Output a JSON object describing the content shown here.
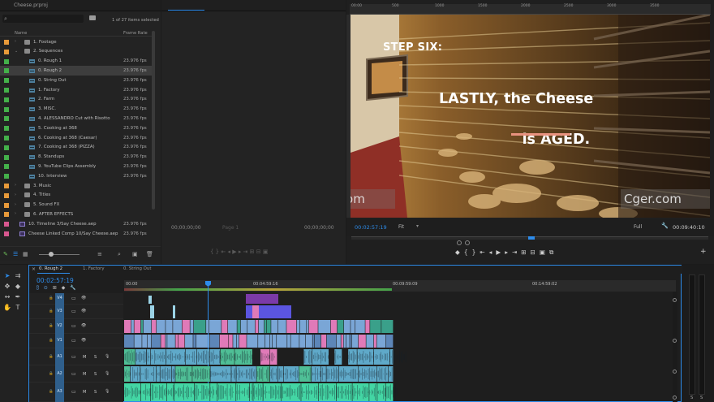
{
  "project": {
    "tab": "Cheese.prproj",
    "search_placeholder": "⌕",
    "selection_count": "1 of 27 items selected",
    "col_name": "Name",
    "col_fps": "Frame Rate",
    "items": [
      {
        "name": "1. Footage",
        "fps": "",
        "type": "folder",
        "label": "#e89a3a",
        "indent": 0
      },
      {
        "name": "2. Sequences",
        "fps": "",
        "type": "folder",
        "label": "#e89a3a",
        "indent": 0,
        "open": true
      },
      {
        "name": "0. Rough 1",
        "fps": "23.976 fps",
        "type": "seq",
        "label": "#44b04a",
        "indent": 1
      },
      {
        "name": "0. Rough 2",
        "fps": "23.976 fps",
        "type": "seq",
        "label": "#44b04a",
        "indent": 1,
        "selected": true
      },
      {
        "name": "0. String Out",
        "fps": "23.976 fps",
        "type": "seq",
        "label": "#44b04a",
        "indent": 1
      },
      {
        "name": "1. Factory",
        "fps": "23.976 fps",
        "type": "seq",
        "label": "#44b04a",
        "indent": 1
      },
      {
        "name": "2. Farm",
        "fps": "23.976 fps",
        "type": "seq",
        "label": "#44b04a",
        "indent": 1
      },
      {
        "name": "3. MISC.",
        "fps": "23.976 fps",
        "type": "seq",
        "label": "#44b04a",
        "indent": 1
      },
      {
        "name": "4. ALESSANDRO Cut with Risotto",
        "fps": "23.976 fps",
        "type": "seq",
        "label": "#44b04a",
        "indent": 1
      },
      {
        "name": "5. Cooking at 368",
        "fps": "23.976 fps",
        "type": "seq",
        "label": "#44b04a",
        "indent": 1
      },
      {
        "name": "6. Cooking at 368 (Caesar)",
        "fps": "23.976 fps",
        "type": "seq",
        "label": "#44b04a",
        "indent": 1
      },
      {
        "name": "7. Cooking at 368 (PIZZA)",
        "fps": "23.976 fps",
        "type": "seq",
        "label": "#44b04a",
        "indent": 1
      },
      {
        "name": "8. Standups",
        "fps": "23.976 fps",
        "type": "seq",
        "label": "#44b04a",
        "indent": 1
      },
      {
        "name": "9. YouTube Clips Assembly",
        "fps": "23.976 fps",
        "type": "seq",
        "label": "#44b04a",
        "indent": 1
      },
      {
        "name": "10. Interview",
        "fps": "23.976 fps",
        "type": "seq",
        "label": "#44b04a",
        "indent": 1
      },
      {
        "name": "3. Music",
        "fps": "",
        "type": "folder",
        "label": "#e89a3a",
        "indent": 0
      },
      {
        "name": "4. Titles",
        "fps": "",
        "type": "folder",
        "label": "#e89a3a",
        "indent": 0
      },
      {
        "name": "5. Sound FX",
        "fps": "",
        "type": "folder",
        "label": "#e89a3a",
        "indent": 0
      },
      {
        "name": "6. AFTER EFFECTS",
        "fps": "",
        "type": "folder",
        "label": "#e89a3a",
        "indent": 0
      },
      {
        "name": "10. Timeline 3/Say Cheese.aep",
        "fps": "23.976 fps",
        "type": "ae",
        "label": "#d8578f",
        "indent": 0
      },
      {
        "name": "Cheese Linked Comp 10/Say Cheese.aep",
        "fps": "23.976 fps",
        "type": "ae",
        "label": "#d8578f",
        "indent": 0
      }
    ]
  },
  "source": {
    "tc_left": "00;00;00;00",
    "page": "Page 1",
    "tc_right": "00;00;00;00"
  },
  "program": {
    "ruler": [
      "00:00",
      "500",
      "1000",
      "1500",
      "2000",
      "2500",
      "3000",
      "3500"
    ],
    "title_small": "STEP SIX:",
    "title_big_1": "LASTLY, the Cheese",
    "title_big_2_a": "is ",
    "title_big_2_b": "AGED.",
    "watermark_left": "Cger.com",
    "watermark_right": "Cger.com",
    "timecode": "00:02:57:19",
    "fit": "Fit",
    "quality": "Full",
    "duration": "00:09:40:10"
  },
  "timeline": {
    "tabs": [
      "0. Rough 2",
      "1. Factory",
      "0. String Out"
    ],
    "timecode": "00:02:57:19",
    "ruler": [
      "00:00",
      "00:04:59:16",
      "00:09:59:09",
      "00:14:59:02"
    ],
    "video_tracks": [
      "V4",
      "V3",
      "V2",
      "V1"
    ],
    "audio_tracks": [
      "A1",
      "A2",
      "A3"
    ],
    "mute": "M",
    "solo": "S"
  },
  "meter": {
    "labels": [
      "S",
      "S"
    ]
  },
  "colors": {
    "accent": "#2d8ceb",
    "video": "#7aa6d6",
    "pink": "#e07ab8",
    "audio": "#5fa9c9",
    "mint": "#43d6a4"
  }
}
